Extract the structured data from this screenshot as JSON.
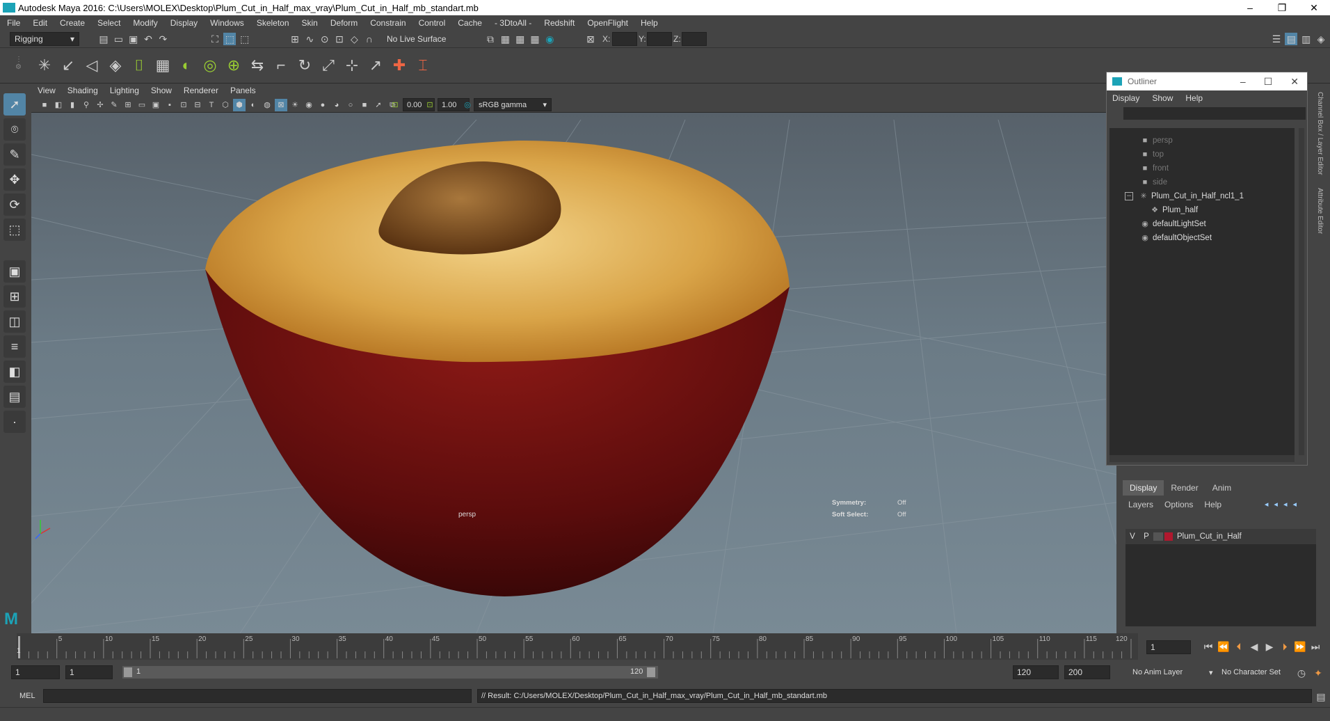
{
  "window": {
    "title": "Autodesk Maya 2016: C:\\Users\\MOLEX\\Desktop\\Plum_Cut_in_Half_max_vray\\Plum_Cut_in_Half_mb_standart.mb"
  },
  "menu": [
    "File",
    "Edit",
    "Create",
    "Select",
    "Modify",
    "Display",
    "Windows",
    "Skeleton",
    "Skin",
    "Deform",
    "Constrain",
    "Control",
    "Cache",
    "- 3DtoAll -",
    "Redshift",
    "OpenFlight",
    "Help"
  ],
  "status": {
    "mode": "Rigging",
    "live_surface": "No Live Surface",
    "x_label": "X:",
    "y_label": "Y:",
    "z_label": "Z:"
  },
  "viewport": {
    "menu": [
      "View",
      "Shading",
      "Lighting",
      "Show",
      "Renderer",
      "Panels"
    ],
    "exposure": "0.00",
    "gamma": "1.00",
    "color_space": "sRGB gamma",
    "camera_label": "persp",
    "symmetry_label": "Symmetry:",
    "symmetry_value": "Off",
    "soft_select_label": "Soft Select:",
    "soft_select_value": "Off"
  },
  "outliner": {
    "title": "Outliner",
    "menu": [
      "Display",
      "Show",
      "Help"
    ],
    "items": [
      {
        "label": "persp",
        "dim": true
      },
      {
        "label": "top",
        "dim": true
      },
      {
        "label": "front",
        "dim": true
      },
      {
        "label": "side",
        "dim": true
      },
      {
        "label": "Plum_Cut_in_Half_ncl1_1",
        "dim": false
      },
      {
        "label": "Plum_half",
        "dim": false
      },
      {
        "label": "defaultLightSet",
        "dim": false
      },
      {
        "label": "defaultObjectSet",
        "dim": false
      }
    ]
  },
  "layers": {
    "tabs": [
      "Display",
      "Render",
      "Anim"
    ],
    "menu": [
      "Layers",
      "Options",
      "Help"
    ],
    "row": {
      "v": "V",
      "p": "P",
      "name": "Plum_Cut_in_Half",
      "color": "#b0182e"
    }
  },
  "timeline": {
    "ticks": [
      "5",
      "10",
      "15",
      "20",
      "25",
      "30",
      "35",
      "40",
      "45",
      "50",
      "55",
      "60",
      "65",
      "70",
      "75",
      "80",
      "85",
      "90",
      "95",
      "100",
      "105",
      "110",
      "115",
      "120"
    ],
    "current_frame": "1"
  },
  "range": {
    "start": "1",
    "start2": "1",
    "slider_start": "1",
    "slider_end": "120",
    "end": "120",
    "end2": "200",
    "anim_layer": "No Anim Layer",
    "character_set": "No Character Set"
  },
  "command": {
    "lang": "MEL",
    "result": "// Result: C:/Users/MOLEX/Desktop/Plum_Cut_in_Half_max_vray/Plum_Cut_in_Half_mb_standart.mb"
  },
  "side_tabs": [
    "Channel Box / Layer Editor",
    "Attribute Editor"
  ],
  "colors": {
    "accent": "#1ca3b7",
    "bg": "#444444",
    "field": "#2b2b2b"
  }
}
